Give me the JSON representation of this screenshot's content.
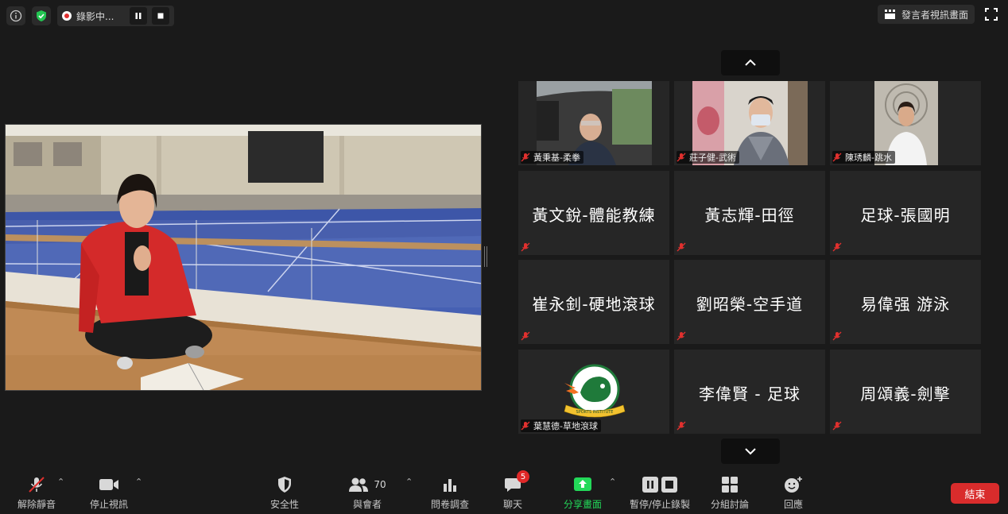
{
  "top_bar": {
    "info_icon": "info-icon",
    "security_icon": "shield-check-icon",
    "recording_label": "錄影中...",
    "speaker_view_label": "發言者視訊畫面"
  },
  "gallery": {
    "tiles": [
      {
        "name": "黃秉基-柔拳",
        "has_video": true
      },
      {
        "name": "莊子健-武術",
        "has_video": true
      },
      {
        "name": "陳琇麟-跳水",
        "has_video": true
      },
      {
        "name": "黃文銳-體能教練",
        "has_video": false
      },
      {
        "name": "黃志輝-田徑",
        "has_video": false
      },
      {
        "name": "足球-張國明",
        "has_video": false
      },
      {
        "name": "崔永釗-硬地滾球",
        "has_video": false
      },
      {
        "name": "劉昭榮-空手道",
        "has_video": false
      },
      {
        "name": "易偉强 游泳",
        "has_video": false
      },
      {
        "name": "葉慧德-草地滾球",
        "has_video": false,
        "logo": "SPORTS INSTITUTE"
      },
      {
        "name": "李偉賢 - 足球",
        "has_video": false
      },
      {
        "name": "周頌義-劍擊",
        "has_video": false
      }
    ]
  },
  "toolbar": {
    "unmute": "解除靜音",
    "stop_video": "停止視訊",
    "security": "安全性",
    "participants": "與會者",
    "participants_count": "70",
    "polls": "問卷調查",
    "chat": "聊天",
    "chat_badge": "5",
    "share_screen": "分享畫面",
    "pause_stop_recording": "暫停/停止錄製",
    "breakout_rooms": "分組討論",
    "reactions": "回應",
    "end": "結束"
  },
  "colors": {
    "background": "#1a1a1a",
    "tile": "#262626",
    "share_green": "#23d959",
    "end_red": "#d92c2c",
    "badge_red": "#e02828",
    "muted_red": "#e0302e"
  }
}
